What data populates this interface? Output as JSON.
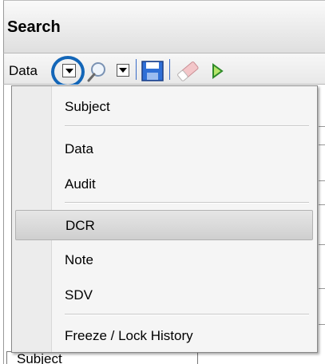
{
  "panel": {
    "title": "Search"
  },
  "toolbar": {
    "view_label": "Data"
  },
  "menu": {
    "items": [
      {
        "label": "Subject"
      },
      {
        "label": "Data"
      },
      {
        "label": "Audit"
      },
      {
        "label": "DCR",
        "selected": true
      },
      {
        "label": "Note"
      },
      {
        "label": "SDV"
      },
      {
        "label": "Freeze / Lock History"
      }
    ]
  },
  "background": {
    "list_item": "Subject"
  },
  "colors": {
    "highlight_ring": "#1366b8",
    "selected_item": "#d8d8d8"
  }
}
